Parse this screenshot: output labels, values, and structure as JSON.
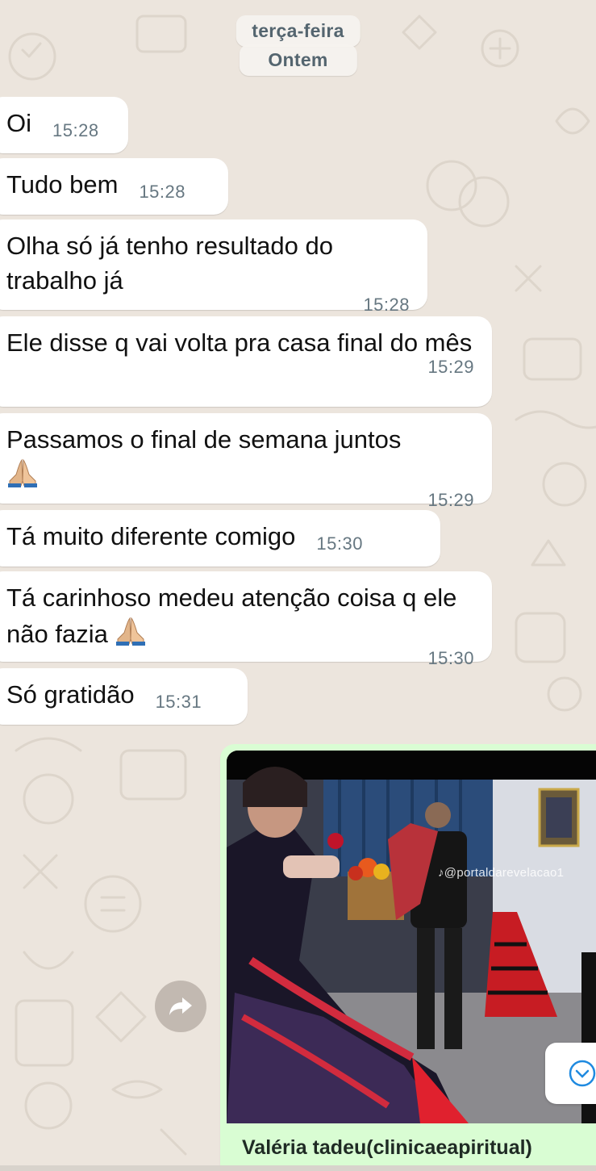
{
  "date_chips": {
    "weekday": "terça-feira",
    "relative": "Ontem"
  },
  "messages": [
    {
      "text": "Oi",
      "time": "15:28"
    },
    {
      "text": "Tudo bem",
      "time": "15:28"
    },
    {
      "text": "Olha só já tenho resultado do trabalho já",
      "time": "15:28"
    },
    {
      "text": "Ele disse q vai volta pra casa final do mês",
      "time": "15:29"
    },
    {
      "text": "Passamos o final de semana juntos",
      "time": "15:29",
      "emoji": "praying-hands"
    },
    {
      "text": "Tá muito diferente comigo",
      "time": "15:30"
    },
    {
      "text": "Tá carinhoso medeu atenção coisa q ele não fazia",
      "time": "15:30",
      "emoji": "praying-hands"
    },
    {
      "text": "Só gratidão",
      "time": "15:31"
    }
  ],
  "video_message": {
    "watermark": "♪@portaldarevelacao1",
    "caption": "Valéria tadeu(clinicaeapiritual)"
  },
  "icons": {
    "forward": "forward-arrow-icon",
    "scroll_down": "chevron-down-circle-icon",
    "tiktok": "tiktok-note-icon"
  },
  "colors": {
    "wallpaper": "#ECE5DD",
    "incoming_bubble": "#FFFFFF",
    "outgoing_bubble": "#D9FDD3",
    "timestamp": "#667781",
    "accent_blue": "#1F8AE0"
  }
}
